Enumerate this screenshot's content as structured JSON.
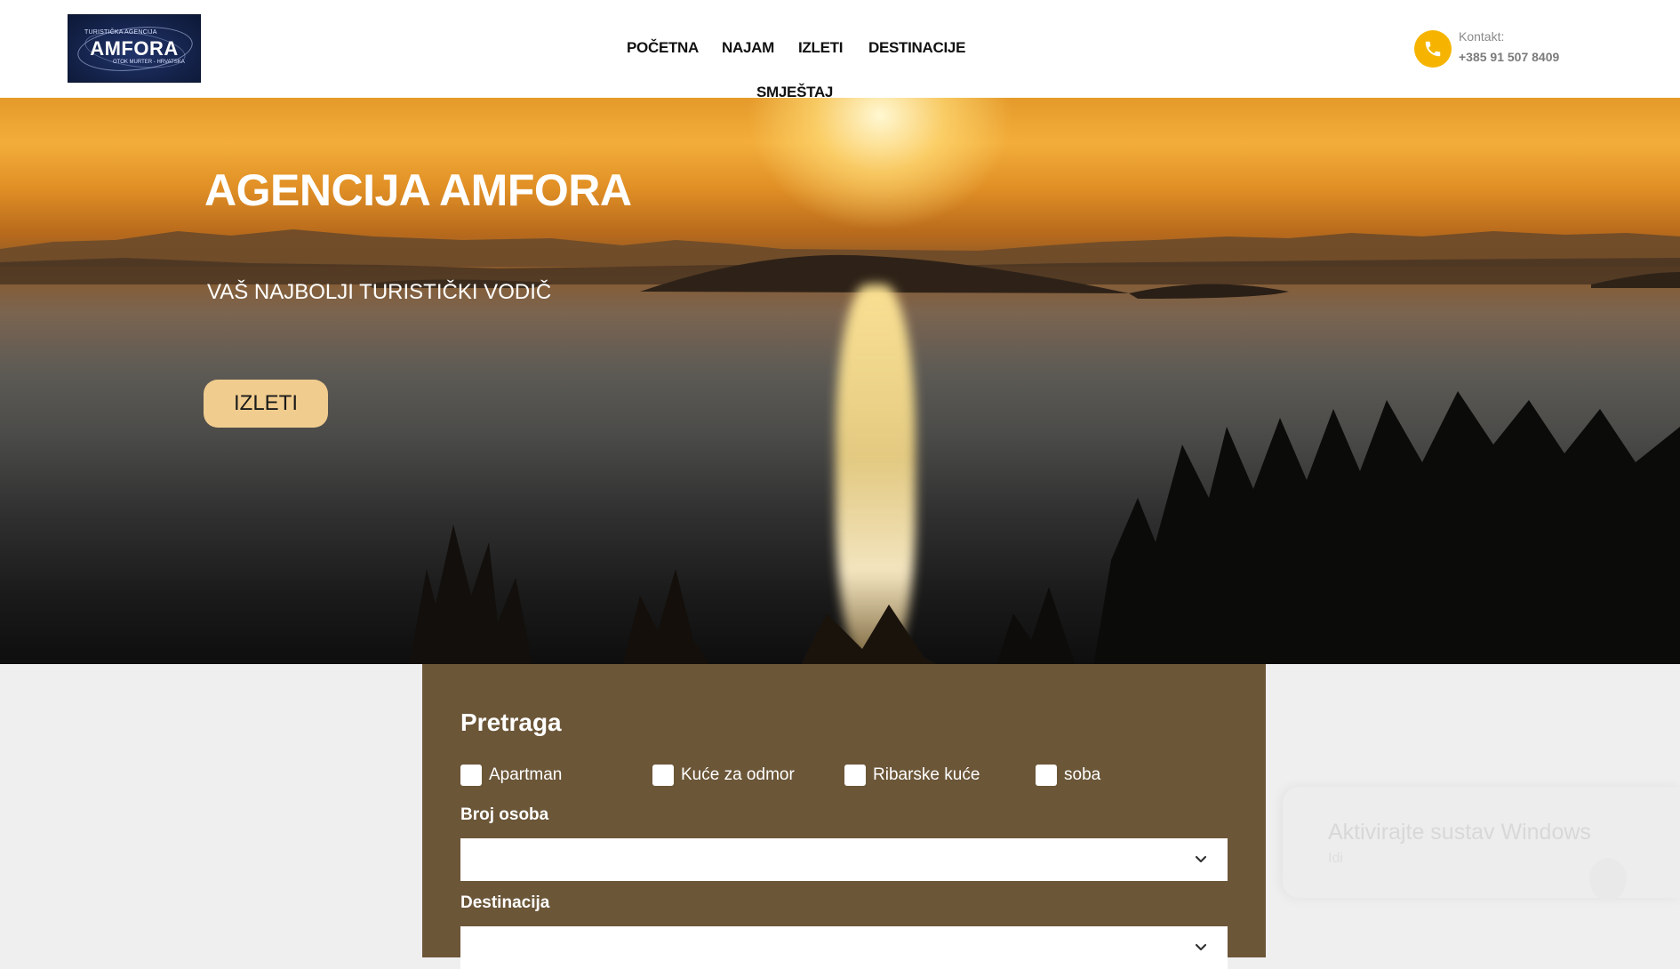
{
  "header": {
    "logo": {
      "top_text": "TURISTIČKA AGENCIJA",
      "name": "AMFORA",
      "bottom_text": "OTOK MURTER - HRVATSKA"
    },
    "nav": [
      {
        "label": "POČETNA"
      },
      {
        "label": "NAJAM"
      },
      {
        "label": "IZLETI"
      },
      {
        "label": "DESTINACIJE"
      },
      {
        "label": "SMJEŠTAJ"
      }
    ],
    "contact": {
      "icon": "phone-icon",
      "label": "Kontakt:",
      "phone": "+385 91 507 8409",
      "icon_color": "#f6b400"
    }
  },
  "hero": {
    "title": "AGENCIJA AMFORA",
    "subtitle": "VAŠ NAJBOLJI TURISTIČKI VODIČ",
    "button_label": "IZLETI",
    "button_color": "#f0cc8e"
  },
  "search": {
    "title": "Pretraga",
    "panel_color": "#6b5638",
    "types": [
      {
        "label": "Apartman",
        "checked": false
      },
      {
        "label": "Kuće za odmor",
        "checked": false
      },
      {
        "label": "Ribarske kuće",
        "checked": false
      },
      {
        "label": "soba",
        "checked": false
      }
    ],
    "persons_label": "Broj osoba",
    "persons_value": "",
    "destination_label": "Destinacija",
    "destination_value": ""
  },
  "watermark": {
    "title": "Aktivirajte sustav Windows",
    "subtitle": "Idi"
  }
}
